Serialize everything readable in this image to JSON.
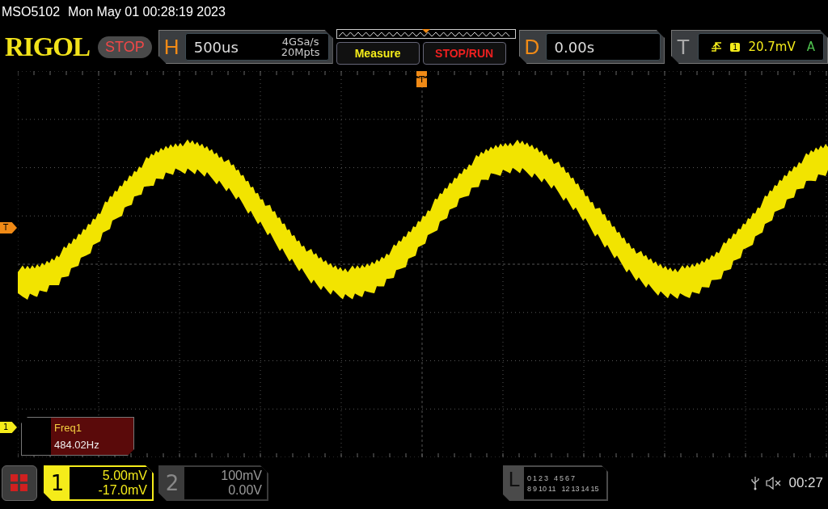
{
  "title_bar": {
    "model": "MSO5102",
    "datetime": "Mon May 01 00:28:19 2023"
  },
  "top_bar": {
    "logo": "RIGOL",
    "run_status": "STOP",
    "horizontal": {
      "label": "H",
      "timebase": "500us",
      "sample_rate": "4GSa/s",
      "memory_depth": "20Mpts"
    },
    "buttons": [
      {
        "label": "Measure",
        "kind": "measure"
      },
      {
        "label": "STOP/RUN",
        "kind": "run"
      }
    ],
    "delay": {
      "label": "D",
      "value": "0.00s"
    },
    "trigger": {
      "label": "T",
      "source": "1",
      "level": "20.7mV",
      "mode": "A"
    }
  },
  "plot": {
    "trigger_position_marker": "T",
    "trigger_level_marker": "T",
    "channel_marker": "1",
    "measurement": {
      "name": "Freq1",
      "value": "484.02Hz"
    }
  },
  "bottom_bar": {
    "channels": [
      {
        "number": "1",
        "scale": "5.00mV",
        "offset": "-17.0mV",
        "selected": true
      },
      {
        "number": "2",
        "scale": "100mV",
        "offset": "0.00V",
        "selected": false
      }
    ],
    "logic": {
      "label": "L",
      "bits_row_1": [
        "0",
        "1",
        "2",
        "3",
        "4",
        "5",
        "6",
        "7"
      ],
      "bits_row_2": [
        "8",
        "9",
        "10",
        "11",
        "12",
        "13",
        "14",
        "15"
      ]
    },
    "clock": "00:27"
  }
}
